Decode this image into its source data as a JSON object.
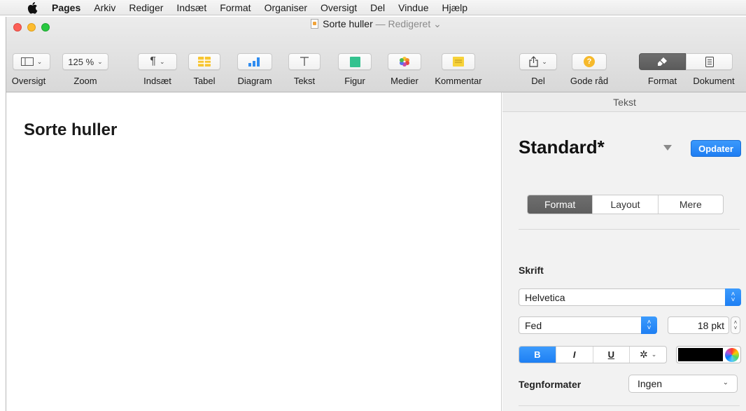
{
  "menubar": {
    "app_name": "Pages",
    "items": [
      "Arkiv",
      "Rediger",
      "Indsæt",
      "Format",
      "Organiser",
      "Oversigt",
      "Del",
      "Vindue",
      "Hjælp"
    ]
  },
  "window": {
    "doc_name": "Sorte huller",
    "edited_label": "— Redigeret"
  },
  "toolbar": {
    "zoom_value": "125 %",
    "labels": {
      "oversigt": "Oversigt",
      "zoom": "Zoom",
      "indsaet": "Indsæt",
      "tabel": "Tabel",
      "diagram": "Diagram",
      "tekst": "Tekst",
      "figur": "Figur",
      "medier": "Medier",
      "kommentar": "Kommentar",
      "del": "Del",
      "gode_raad": "Gode råd",
      "format": "Format",
      "dokument": "Dokument"
    },
    "gode_raad_glyph": "?"
  },
  "document": {
    "heading": "Sorte huller"
  },
  "inspector": {
    "header": "Tekst",
    "style_name": "Standard*",
    "update_button": "Opdater",
    "tabs": [
      "Format",
      "Layout",
      "Mere"
    ],
    "active_tab": "Format",
    "font_section": "Skrift",
    "font_family": "Helvetica",
    "font_style": "Fed",
    "font_size": "18 pkt",
    "format_buttons": {
      "bold": "B",
      "italic": "I",
      "underline": "U"
    },
    "text_color": "#000000",
    "char_styles_label": "Tegnformater",
    "char_styles_value": "Ingen"
  },
  "colors": {
    "accent": "#1e7ff3",
    "close": "#fc5f57",
    "minimize": "#fdbc2e",
    "maximize": "#28c840"
  }
}
